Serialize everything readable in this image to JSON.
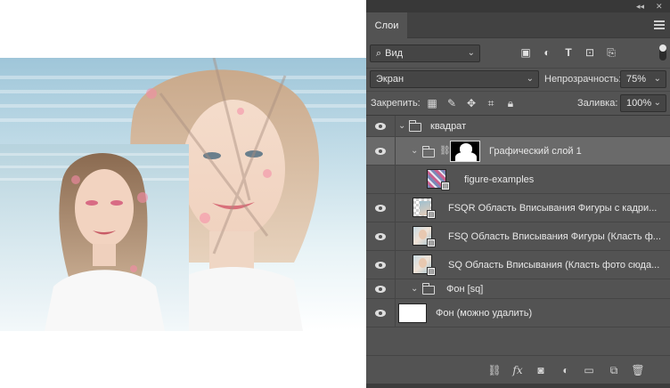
{
  "panel": {
    "tab_label": "Слои",
    "filter": {
      "value": "Вид"
    },
    "blend_mode": "Экран",
    "opacity_label": "Непрозрачность:",
    "opacity_value": "75%",
    "lock_label": "Закрепить:",
    "fill_label": "Заливка:",
    "fill_value": "100%"
  },
  "layers": [
    {
      "name": "квадрат",
      "type": "group",
      "expanded": true,
      "visible": true
    },
    {
      "name": "Графический слой 1",
      "type": "group-with-mask",
      "expanded": true,
      "visible": true,
      "selected": true
    },
    {
      "name": "figure-examples",
      "type": "smart-object",
      "visible": false
    },
    {
      "name": "FSQR Область Вписывания Фигуры с кадри...",
      "type": "smart-object",
      "visible": true
    },
    {
      "name": "FSQ Область Вписывания Фигуры (Класть ф...",
      "type": "smart-object",
      "visible": true
    },
    {
      "name": "SQ Область Вписывания (Класть фото сюда...",
      "type": "smart-object",
      "visible": true
    },
    {
      "name": "Фон [sq]",
      "type": "group",
      "expanded": true,
      "visible": true
    },
    {
      "name": "Фон (можно удалить)",
      "type": "layer",
      "visible": true
    }
  ],
  "icons": {
    "filter": [
      "image-filter-icon",
      "adjustment-filter-icon",
      "type-filter-icon",
      "shape-filter-icon",
      "smart-filter-icon"
    ],
    "lock": [
      "lock-transparent-icon",
      "lock-paint-icon",
      "lock-move-icon",
      "lock-artboard-icon",
      "lock-all-icon"
    ],
    "bottom": [
      "link-layers-icon",
      "fx-icon",
      "add-mask-icon",
      "adjustment-layer-icon",
      "new-group-icon",
      "new-layer-icon",
      "trash-icon"
    ]
  },
  "colors": {
    "panel_bg": "#535353",
    "selected_row": "#6a6a6a"
  }
}
